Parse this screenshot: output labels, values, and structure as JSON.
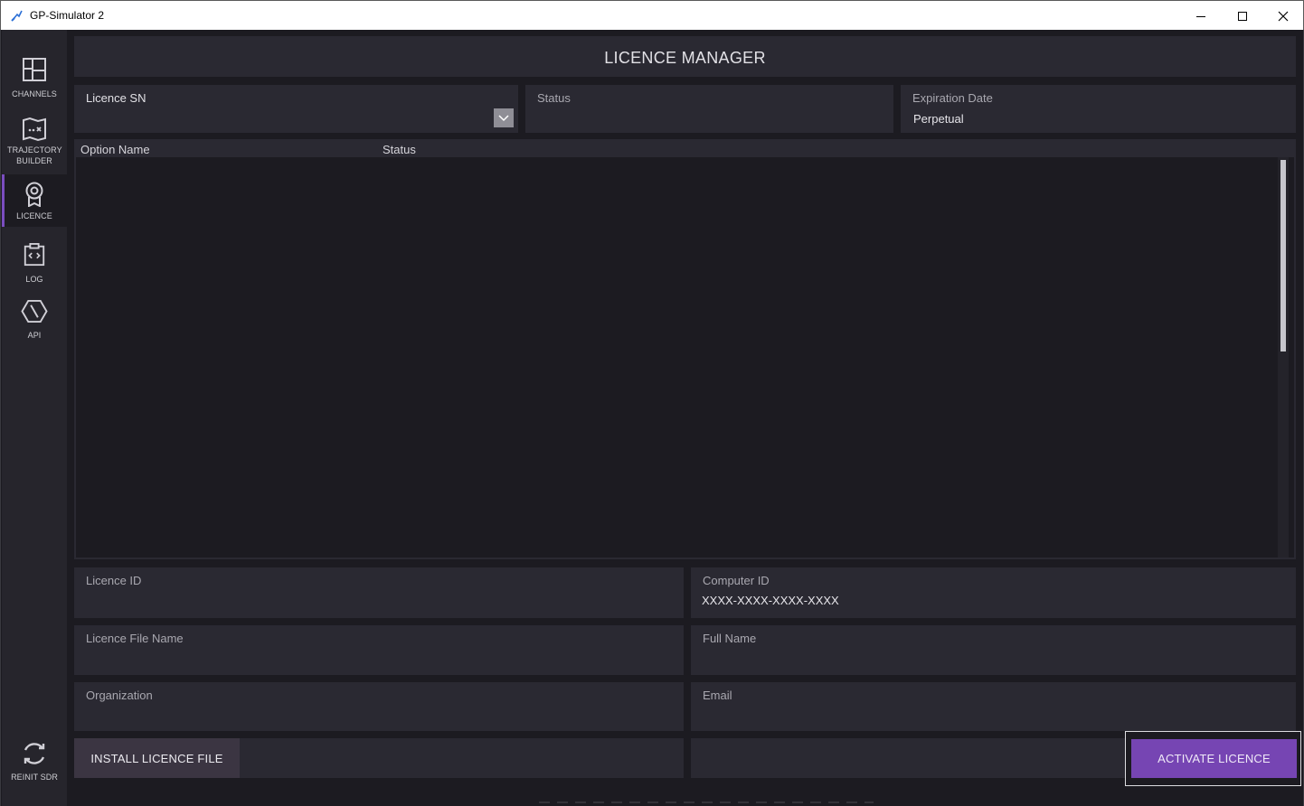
{
  "window": {
    "title": "GP-Simulator 2",
    "controls": {
      "minimize": "minimize-icon",
      "maximize": "maximize-icon",
      "close": "close-icon"
    }
  },
  "sidebar": {
    "items": [
      {
        "label": "CHANNELS",
        "icon": "grid-layout-icon"
      },
      {
        "label": "TRAJECTORY BUILDER",
        "icon": "map-icon"
      },
      {
        "label": "LICENCE",
        "icon": "certificate-icon",
        "active": true
      },
      {
        "label": "LOG",
        "icon": "code-clipboard-icon"
      },
      {
        "label": "API",
        "icon": "api-icon"
      }
    ],
    "reinit": {
      "label": "REINIT SDR",
      "icon": "refresh-icon"
    }
  },
  "header": {
    "title": "LICENCE MANAGER"
  },
  "licence_sn": {
    "label": "Licence SN",
    "value": ""
  },
  "status": {
    "label": "Status",
    "value": ""
  },
  "expiration": {
    "label": "Expiration Date",
    "value": "Perpetual"
  },
  "options_table": {
    "columns": [
      "Option Name",
      "Status"
    ],
    "rows": []
  },
  "fields": {
    "licence_id": {
      "label": "Licence ID",
      "value": ""
    },
    "computer_id": {
      "label": "Computer ID",
      "value": "XXXX-XXXX-XXXX-XXXX"
    },
    "licence_file_name": {
      "label": "Licence File Name",
      "value": ""
    },
    "full_name": {
      "label": "Full Name",
      "value": ""
    },
    "organization": {
      "label": "Organization",
      "value": ""
    },
    "email": {
      "label": "Email",
      "value": ""
    }
  },
  "buttons": {
    "install": "INSTALL LICENCE FILE",
    "activate": "ACTIVATE LICENCE"
  },
  "colors": {
    "accent": "#7645b3",
    "background": "#1c1b21",
    "panel": "#2a2932",
    "sidebar": "#26252c"
  }
}
